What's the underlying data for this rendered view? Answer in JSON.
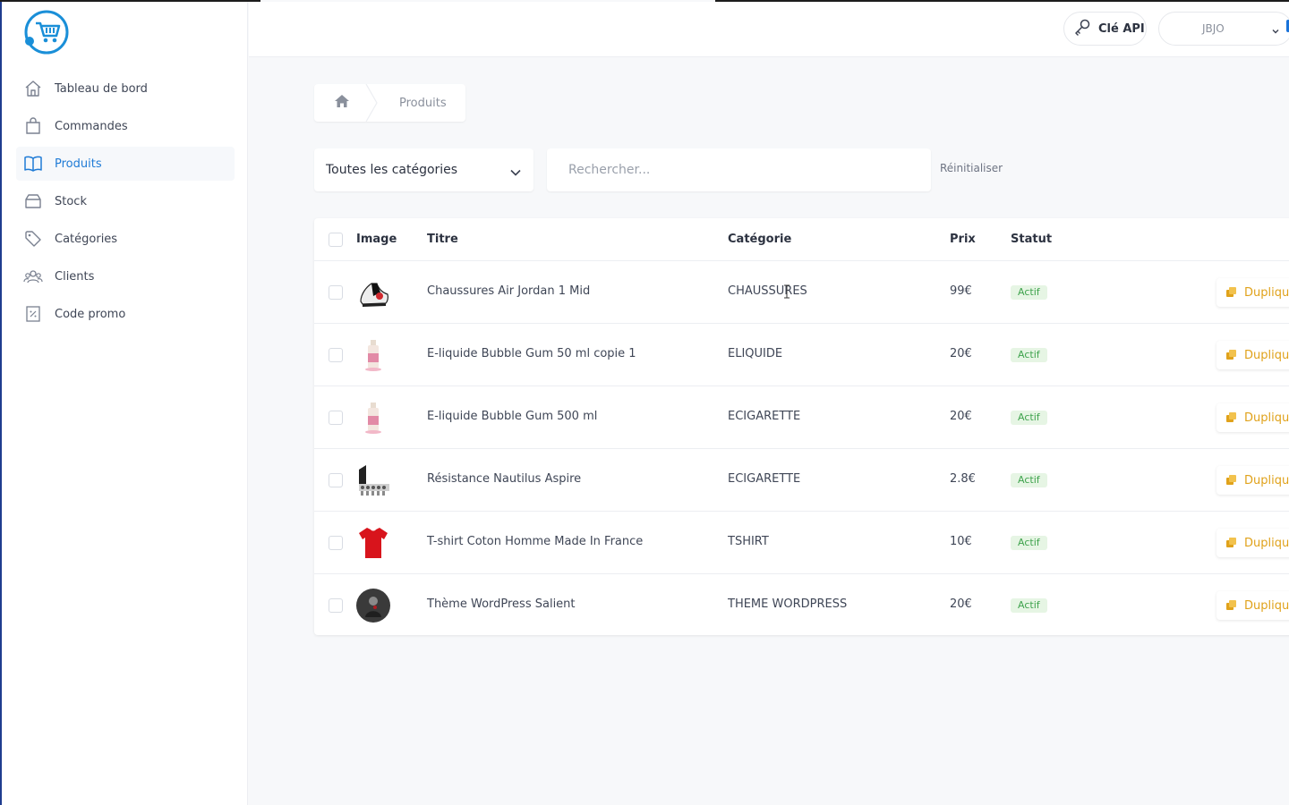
{
  "sidebar": {
    "items": [
      {
        "label": "Tableau de bord",
        "icon": "home-icon"
      },
      {
        "label": "Commandes",
        "icon": "bag-icon"
      },
      {
        "label": "Produits",
        "icon": "book-icon",
        "active": true
      },
      {
        "label": "Stock",
        "icon": "box-icon"
      },
      {
        "label": "Catégories",
        "icon": "tag-icon"
      },
      {
        "label": "Clients",
        "icon": "users-icon"
      },
      {
        "label": "Code promo",
        "icon": "coupon-icon"
      }
    ]
  },
  "topbar": {
    "api_label": "Clé API",
    "user_label": "JBJO"
  },
  "breadcrumb": {
    "current": "Produits"
  },
  "filters": {
    "category_label": "Toutes les catégories",
    "search_placeholder": "Rechercher...",
    "reset_label": "Réinitialiser"
  },
  "table": {
    "headers": {
      "image": "Image",
      "title": "Titre",
      "category": "Catégorie",
      "price": "Prix",
      "status": "Statut"
    },
    "rows": [
      {
        "title": "Chaussures Air Jordan 1 Mid",
        "category": "CHAUSSURES",
        "price": "99€",
        "status": "Actif",
        "action": "Dupliqu",
        "thumb": "sneaker"
      },
      {
        "title": "E-liquide Bubble Gum 50 ml copie 1",
        "category": "ELIQUIDE",
        "price": "20€",
        "status": "Actif",
        "action": "Dupliqu",
        "thumb": "bottle"
      },
      {
        "title": "E-liquide Bubble Gum 500 ml",
        "category": "ECIGARETTE",
        "price": "20€",
        "status": "Actif",
        "action": "Dupliqu",
        "thumb": "bottle"
      },
      {
        "title": "Résistance Nautilus Aspire",
        "category": "ECIGARETTE",
        "price": "2.8€",
        "status": "Actif",
        "action": "Dupliqu",
        "thumb": "coils"
      },
      {
        "title": "T-shirt Coton Homme Made In France",
        "category": "TSHIRT",
        "price": "10€",
        "status": "Actif",
        "action": "Dupliqu",
        "thumb": "tshirt"
      },
      {
        "title": "Thème WordPress Salient",
        "category": "THEME WORDPRESS",
        "price": "20€",
        "status": "Actif",
        "action": "Dupliqu",
        "thumb": "avatar"
      }
    ]
  },
  "colors": {
    "accent": "#1f7bd6",
    "active_badge_bg": "#e6f5e4",
    "active_badge_text": "#3fa34d",
    "duplicate": "#e0a21b"
  }
}
